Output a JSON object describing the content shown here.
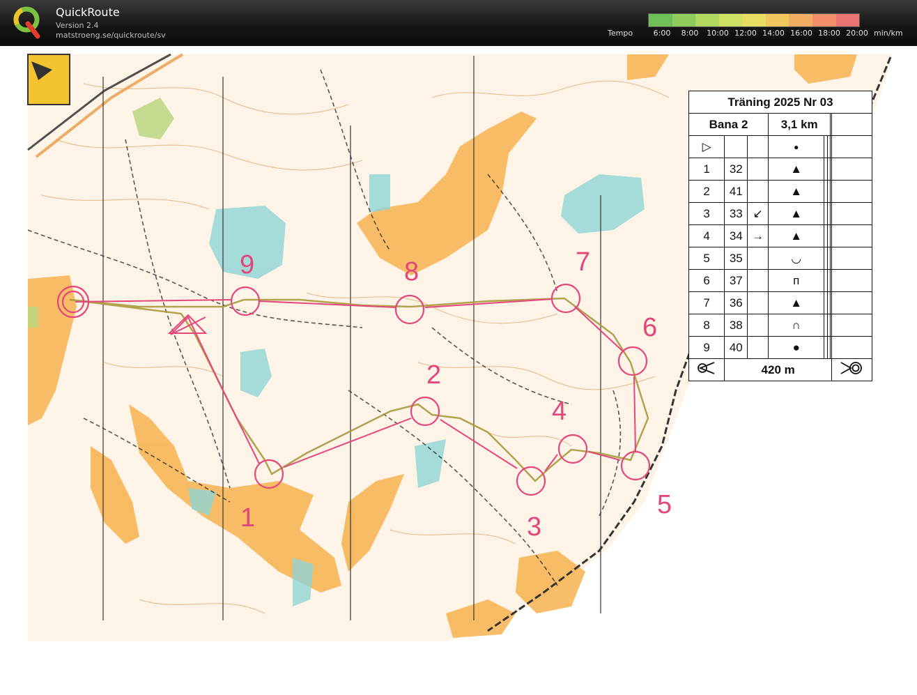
{
  "app": {
    "name": "QuickRoute",
    "version": "Version 2.4",
    "url": "matstroeng.se/quickroute/sv"
  },
  "tempo": {
    "label": "Tempo",
    "ticks": [
      "6:00",
      "8:00",
      "10:00",
      "12:00",
      "14:00",
      "16:00",
      "18:00",
      "20:00"
    ],
    "unit": "min/km",
    "colors": [
      "#6fbf58",
      "#8fcc5c",
      "#b0d85f",
      "#cfe163",
      "#e6dd62",
      "#f0c75e",
      "#f3ad62",
      "#f28f6a",
      "#ee7373"
    ]
  },
  "map": {
    "course_color": "#e3467a",
    "route_color": "#c9a84a",
    "controls": [
      {
        "num": "1"
      },
      {
        "num": "2"
      },
      {
        "num": "3"
      },
      {
        "num": "4"
      },
      {
        "num": "5"
      },
      {
        "num": "6"
      },
      {
        "num": "7"
      },
      {
        "num": "8"
      },
      {
        "num": "9"
      }
    ]
  },
  "legend": {
    "title": "Träning 2025 Nr 03",
    "course": "Bana 2",
    "length": "3,1 km",
    "rows": [
      {
        "n": "1",
        "code": "32",
        "dir": "",
        "sym": "▲"
      },
      {
        "n": "2",
        "code": "41",
        "dir": "",
        "sym": "▲"
      },
      {
        "n": "3",
        "code": "33",
        "dir": "↙",
        "sym": "▲"
      },
      {
        "n": "4",
        "code": "34",
        "dir": "→",
        "sym": "▲"
      },
      {
        "n": "5",
        "code": "35",
        "dir": "",
        "sym": "◡"
      },
      {
        "n": "6",
        "code": "37",
        "dir": "",
        "sym": "ᴨ"
      },
      {
        "n": "7",
        "code": "36",
        "dir": "",
        "sym": "▲"
      },
      {
        "n": "8",
        "code": "38",
        "dir": "",
        "sym": "∩"
      },
      {
        "n": "9",
        "code": "40",
        "dir": "",
        "sym": "●"
      }
    ],
    "start_sym": "▷",
    "start_dot": "●",
    "finish_dist": "420 m"
  }
}
